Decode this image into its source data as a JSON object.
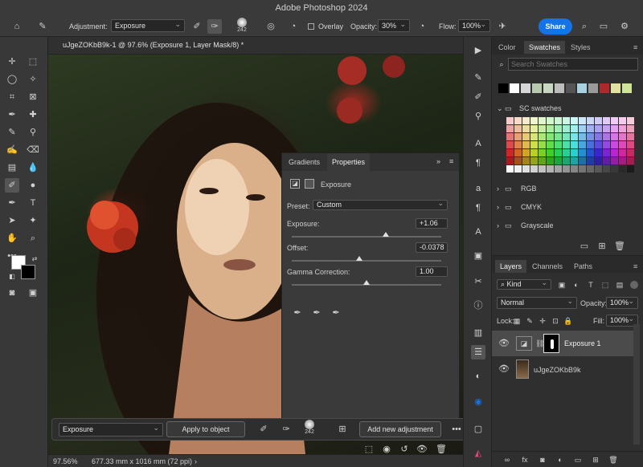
{
  "app": {
    "title": "Adobe Photoshop 2024"
  },
  "options": {
    "adjustment_label": "Adjustment:",
    "adjustment_value": "Exposure",
    "brush_size": "242",
    "overlay_label": "Overlay",
    "opacity_label": "Opacity:",
    "opacity_value": "30%",
    "flow_label": "Flow:",
    "flow_value": "100%",
    "share_label": "Share"
  },
  "document": {
    "tab_title": "uJgeZOKbB9k-1 @ 97.6% (Exposure 1, Layer Mask/8) *",
    "zoom": "97.56%",
    "dimensions": "677.33 mm x 1016 mm (72 ppi)"
  },
  "swatches_panel": {
    "tabs": [
      "Color",
      "Swatches",
      "Styles"
    ],
    "search_placeholder": "Search Swatches",
    "groups": [
      "SC swatches",
      "RGB",
      "CMYK",
      "Grayscale"
    ],
    "recent_colors": [
      "#000000",
      "#ffffff",
      "#d6d6d6",
      "#b8c9b0",
      "#c9d6c4",
      "#bdbdbd",
      "#555555",
      "#a8d2e0",
      "#9a9a9a",
      "#ad2a2a",
      "#e2e2a0",
      "#cfe39a"
    ]
  },
  "properties_panel": {
    "tabs": [
      "Gradients",
      "Properties"
    ],
    "layer_type": "Exposure",
    "preset_label": "Preset:",
    "preset_value": "Custom",
    "exposure_label": "Exposure:",
    "exposure_value": "+1.06",
    "exposure_level": 0.63,
    "offset_label": "Offset:",
    "offset_value": "-0.0378",
    "offset_level": 0.45,
    "gamma_label": "Gamma Correction:",
    "gamma_value": "1.00",
    "gamma_level": 0.5
  },
  "context_bar": {
    "adjustment_value": "Exposure",
    "apply_label": "Apply to object",
    "brush_size": "242",
    "new_adjustment_label": "Add new adjustment"
  },
  "layers_panel": {
    "tabs": [
      "Layers",
      "Channels",
      "Paths"
    ],
    "kind_label": "Kind",
    "blend_mode": "Normal",
    "opacity_label": "Opacity:",
    "opacity_value": "100%",
    "lock_label": "Lock:",
    "fill_label": "Fill:",
    "fill_value": "100%",
    "layers": [
      {
        "name": "Exposure 1",
        "visible": true,
        "selected": true
      },
      {
        "name": "uJgeZOKbB9k",
        "visible": true,
        "selected": false
      }
    ]
  }
}
